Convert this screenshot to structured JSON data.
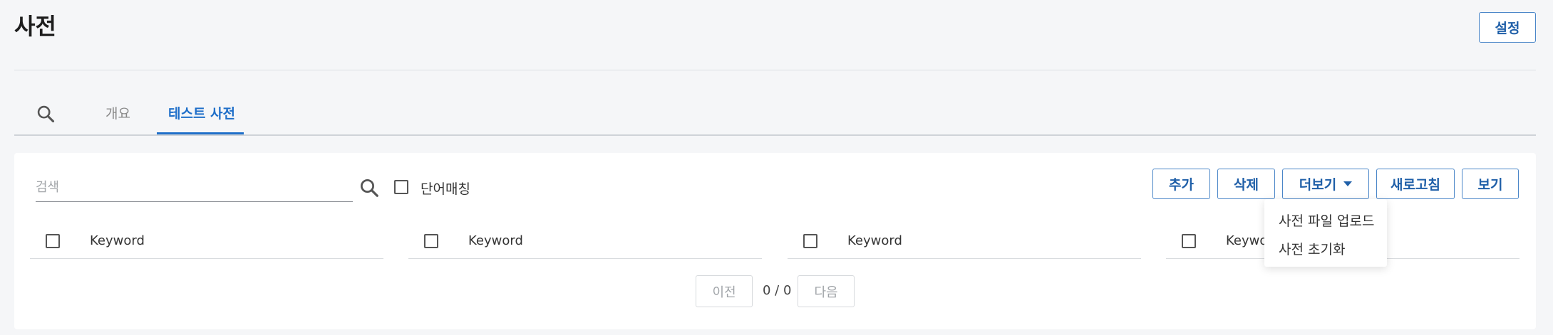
{
  "page": {
    "title": "사전"
  },
  "header": {
    "settings_label": "설정"
  },
  "tabs": [
    {
      "label": "개요"
    },
    {
      "label": "테스트 사전"
    }
  ],
  "toolbar": {
    "search_placeholder": "검색",
    "search_value": "",
    "word_match_label": "단어매칭",
    "add_label": "추가",
    "delete_label": "삭제",
    "more_label": "더보기",
    "refresh_label": "새로고침",
    "view_label": "보기"
  },
  "more_menu": [
    {
      "label": "사전 파일 업로드"
    },
    {
      "label": "사전 초기화"
    }
  ],
  "columns": [
    {
      "label": "Keyword"
    },
    {
      "label": "Keyword"
    },
    {
      "label": "Keyword"
    },
    {
      "label": "Keyword"
    }
  ],
  "pagination": {
    "prev_label": "이전",
    "info": "0 / 0",
    "next_label": "다음"
  },
  "colors": {
    "accent": "#1f6fc9",
    "button_text": "#1f5fa8",
    "background": "#f5f6f8"
  },
  "icons": {
    "tab_search": "search-icon",
    "search": "search-icon",
    "more_caret": "caret-down-icon"
  }
}
